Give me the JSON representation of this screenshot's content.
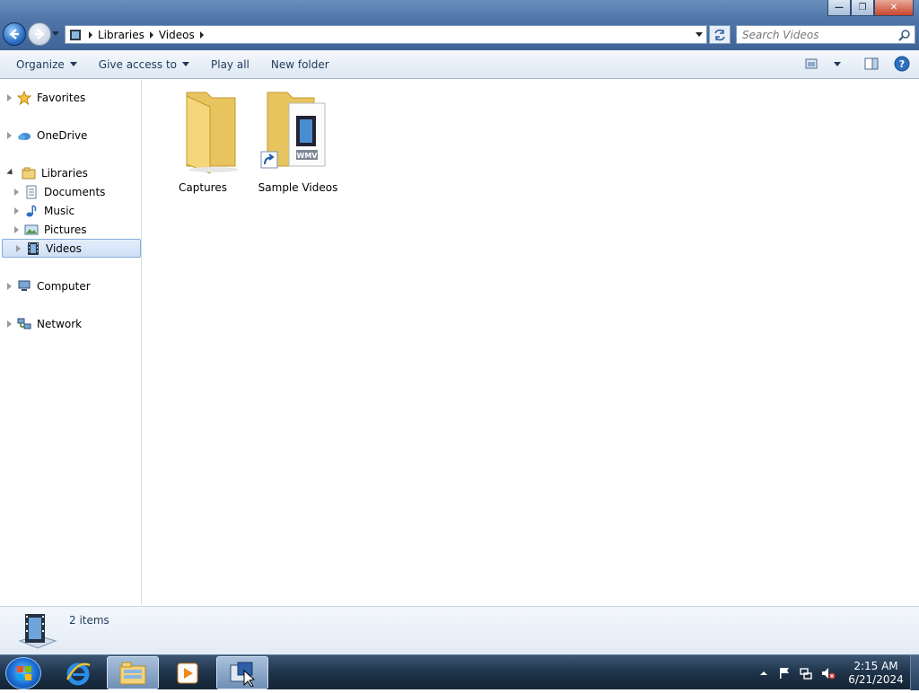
{
  "window": {
    "minimize_glyph": "—",
    "maximize_glyph": "❐",
    "close_glyph": "✕"
  },
  "address": {
    "segments": [
      "Libraries",
      "Videos"
    ]
  },
  "search": {
    "placeholder": "Search Videos"
  },
  "toolbar": {
    "organize": "Organize",
    "give_access": "Give access to",
    "play_all": "Play all",
    "new_folder": "New folder"
  },
  "nav": {
    "favorites": "Favorites",
    "onedrive": "OneDrive",
    "libraries": "Libraries",
    "documents": "Documents",
    "music": "Music",
    "pictures": "Pictures",
    "videos": "Videos",
    "computer": "Computer",
    "network": "Network"
  },
  "items": [
    {
      "name": "Captures",
      "type": "folder"
    },
    {
      "name": "Sample Videos",
      "type": "shortcut-folder",
      "badge": "WMV"
    }
  ],
  "status": {
    "item_count": "2 items"
  },
  "taskbar": {
    "time": "2:15 AM",
    "date": "6/21/2024"
  },
  "colors": {
    "selection_fill": "#cfe0f6",
    "selection_border": "#84acdd",
    "folder": "#f5d67b"
  }
}
